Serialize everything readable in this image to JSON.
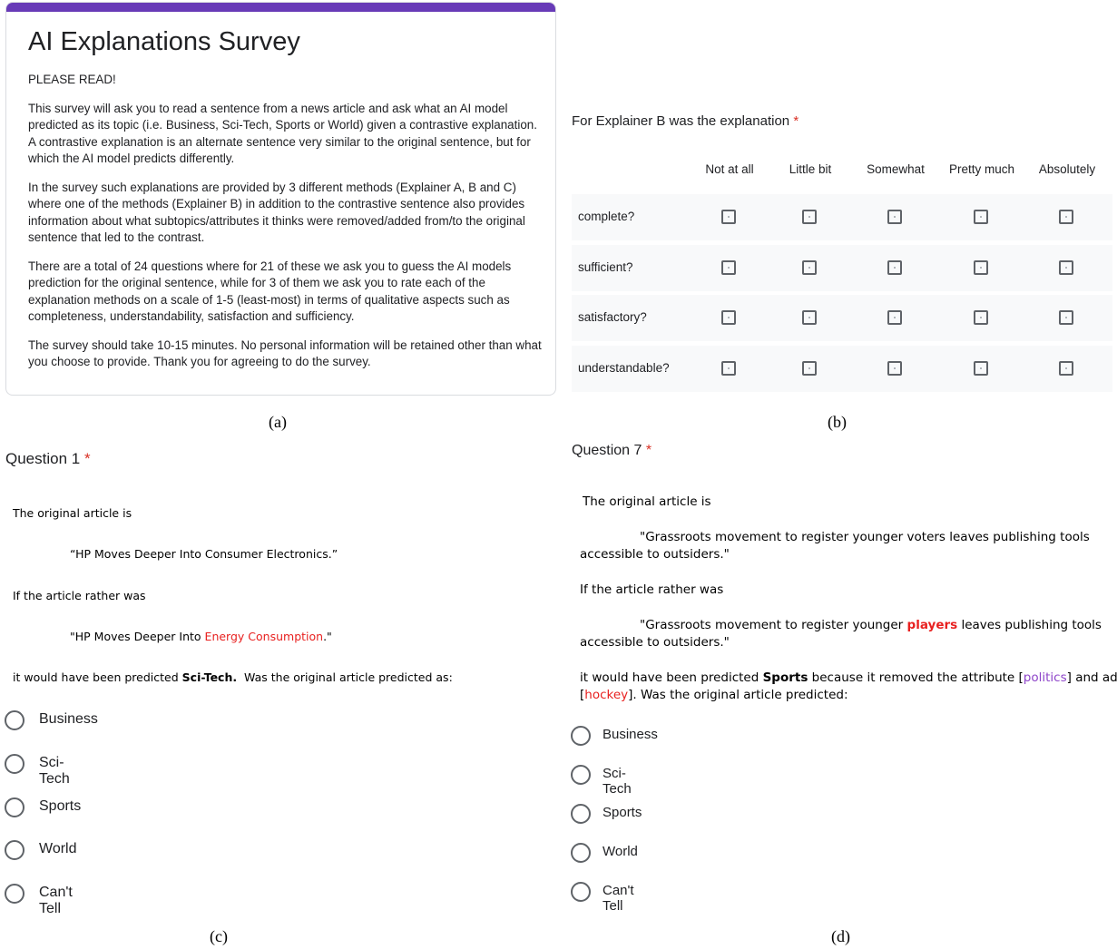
{
  "header": {
    "title": "AI Explanations Survey",
    "notice": "PLEASE READ!",
    "paragraphs": [
      "This survey will ask you to read a sentence from a news article and ask what an AI model predicted as its topic (i.e. Business, Sci-Tech, Sports or World) given a contrastive explanation. A contrastive explanation is an alternate sentence very similar to the original sentence, but for which the AI model predicts differently.",
      "In the survey such explanations are provided by 3 different methods (Explainer A, B and C) where one of the methods (Explainer B) in addition to the contrastive sentence also provides information about what subtopics/attributes it thinks were removed/added from/to the original sentence that led to the contrast.",
      "There are a total of 24 questions where for 21 of these we ask you to guess the AI models prediction for the original sentence, while for 3 of them we ask you to rate each of the explanation methods on a scale of 1-5 (least-most) in terms of qualitative aspects such as completeness, understandability, satisfaction and sufficiency.",
      "The survey should take 10-15 minutes. No personal information will be retained other than what you choose to provide. Thank you for agreeing to do the survey."
    ]
  },
  "grid": {
    "question": "For Explainer B was the explanation",
    "required_mark": "*",
    "columns": [
      "Not at all",
      "Little bit",
      "Somewhat",
      "Pretty much",
      "Absolutely"
    ],
    "rows": [
      "complete?",
      "sufficient?",
      "satisfactory?",
      "understandable?"
    ]
  },
  "captions": {
    "a": "(a)",
    "b": "(b)",
    "c": "(c)",
    "d": "(d)"
  },
  "q1": {
    "title": "Question 1",
    "required_mark": "*",
    "intro": "The original article is",
    "original": "“HP Moves Deeper Into Consumer Electronics.”",
    "if_rather": "If the article rather was",
    "alt_prefix": "\"HP Moves Deeper Into ",
    "alt_changed": "Energy Consumption",
    "alt_suffix": ".\"",
    "pred_prefix": "it would have been predicted ",
    "pred_label": "Sci-Tech.",
    "pred_suffix": "  Was the original article predicted as:",
    "options": [
      "Business",
      "Sci-Tech",
      "Sports",
      "World",
      "Can't Tell"
    ]
  },
  "q7": {
    "title": "Question 7",
    "required_mark": "*",
    "intro": "The original article is",
    "original_line1": "\"Grassroots movement to register younger voters leaves publishing tools",
    "original_line2": "accessible to outsiders.\"",
    "if_rather": "If the article rather was",
    "alt_prefix": "\"Grassroots movement to register younger ",
    "alt_changed": "players",
    "alt_suffix": " leaves publishing tools",
    "alt_line2": "accessible to outsiders.\"",
    "pred_prefix": "it would have been predicted ",
    "pred_label": "Sports",
    "pred_mid": " because it removed the attribute [",
    "removed_attr": "politics",
    "pred_mid2": "] and added",
    "pred_line2_open": "[",
    "added_attr": "hockey",
    "pred_line2_close": "]. Was the original article predicted:",
    "options": [
      "Business",
      "Sci-Tech",
      "Sports",
      "World",
      "Can't Tell"
    ]
  },
  "colors": {
    "accent": "#673ab7",
    "required": "#d93025",
    "changed_word": "#e8201f",
    "removed_attr": "#8e44c9"
  }
}
